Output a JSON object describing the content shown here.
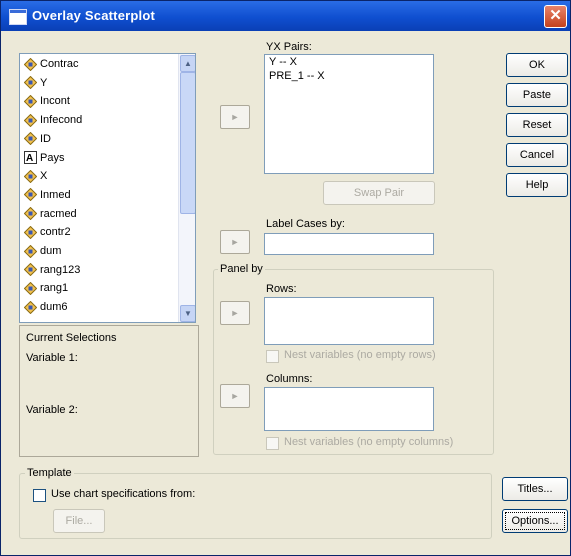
{
  "window": {
    "title": "Overlay Scatterplot",
    "close_glyph": "✕"
  },
  "variables": [
    {
      "name": "Contrac",
      "icon": "scale-variable-icon"
    },
    {
      "name": "Y",
      "icon": "scale-variable-icon"
    },
    {
      "name": "Incont",
      "icon": "scale-variable-icon"
    },
    {
      "name": "Infecond",
      "icon": "scale-variable-icon"
    },
    {
      "name": "ID",
      "icon": "scale-variable-icon"
    },
    {
      "name": "Pays",
      "icon": "string-variable-icon"
    },
    {
      "name": "X",
      "icon": "scale-variable-icon"
    },
    {
      "name": "Inmed",
      "icon": "scale-variable-icon"
    },
    {
      "name": "racmed",
      "icon": "scale-variable-icon"
    },
    {
      "name": "contr2",
      "icon": "scale-variable-icon"
    },
    {
      "name": "dum",
      "icon": "scale-variable-icon"
    },
    {
      "name": "rang123",
      "icon": "scale-variable-icon"
    },
    {
      "name": "rang1",
      "icon": "scale-variable-icon"
    },
    {
      "name": "dum6",
      "icon": "scale-variable-icon"
    }
  ],
  "current_selections": {
    "heading": "Current Selections",
    "variable1_label": "Variable 1:",
    "variable2_label": "Variable 2:"
  },
  "yx_pairs": {
    "label": "YX Pairs:",
    "items": [
      "Y -- X",
      "PRE_1 -- X"
    ],
    "swap_label": "Swap Pair"
  },
  "label_cases": {
    "label": "Label Cases by:",
    "value": ""
  },
  "panel_by": {
    "title": "Panel by",
    "rows_label": "Rows:",
    "rows_nest_label": "Nest variables (no empty rows)",
    "columns_label": "Columns:",
    "columns_nest_label": "Nest variables (no empty columns)"
  },
  "template": {
    "title": "Template",
    "checkbox_label": "Use chart specifications from:",
    "file_button": "File..."
  },
  "buttons": {
    "ok": "OK",
    "paste": "Paste",
    "reset": "Reset",
    "cancel": "Cancel",
    "help": "Help",
    "titles": "Titles...",
    "options": "Options..."
  },
  "arrow_glyph": "►",
  "colors": {
    "titlebar": "#0f4fd0",
    "dialog_bg": "#ece9d8",
    "disabled_text": "#acaaa2"
  }
}
